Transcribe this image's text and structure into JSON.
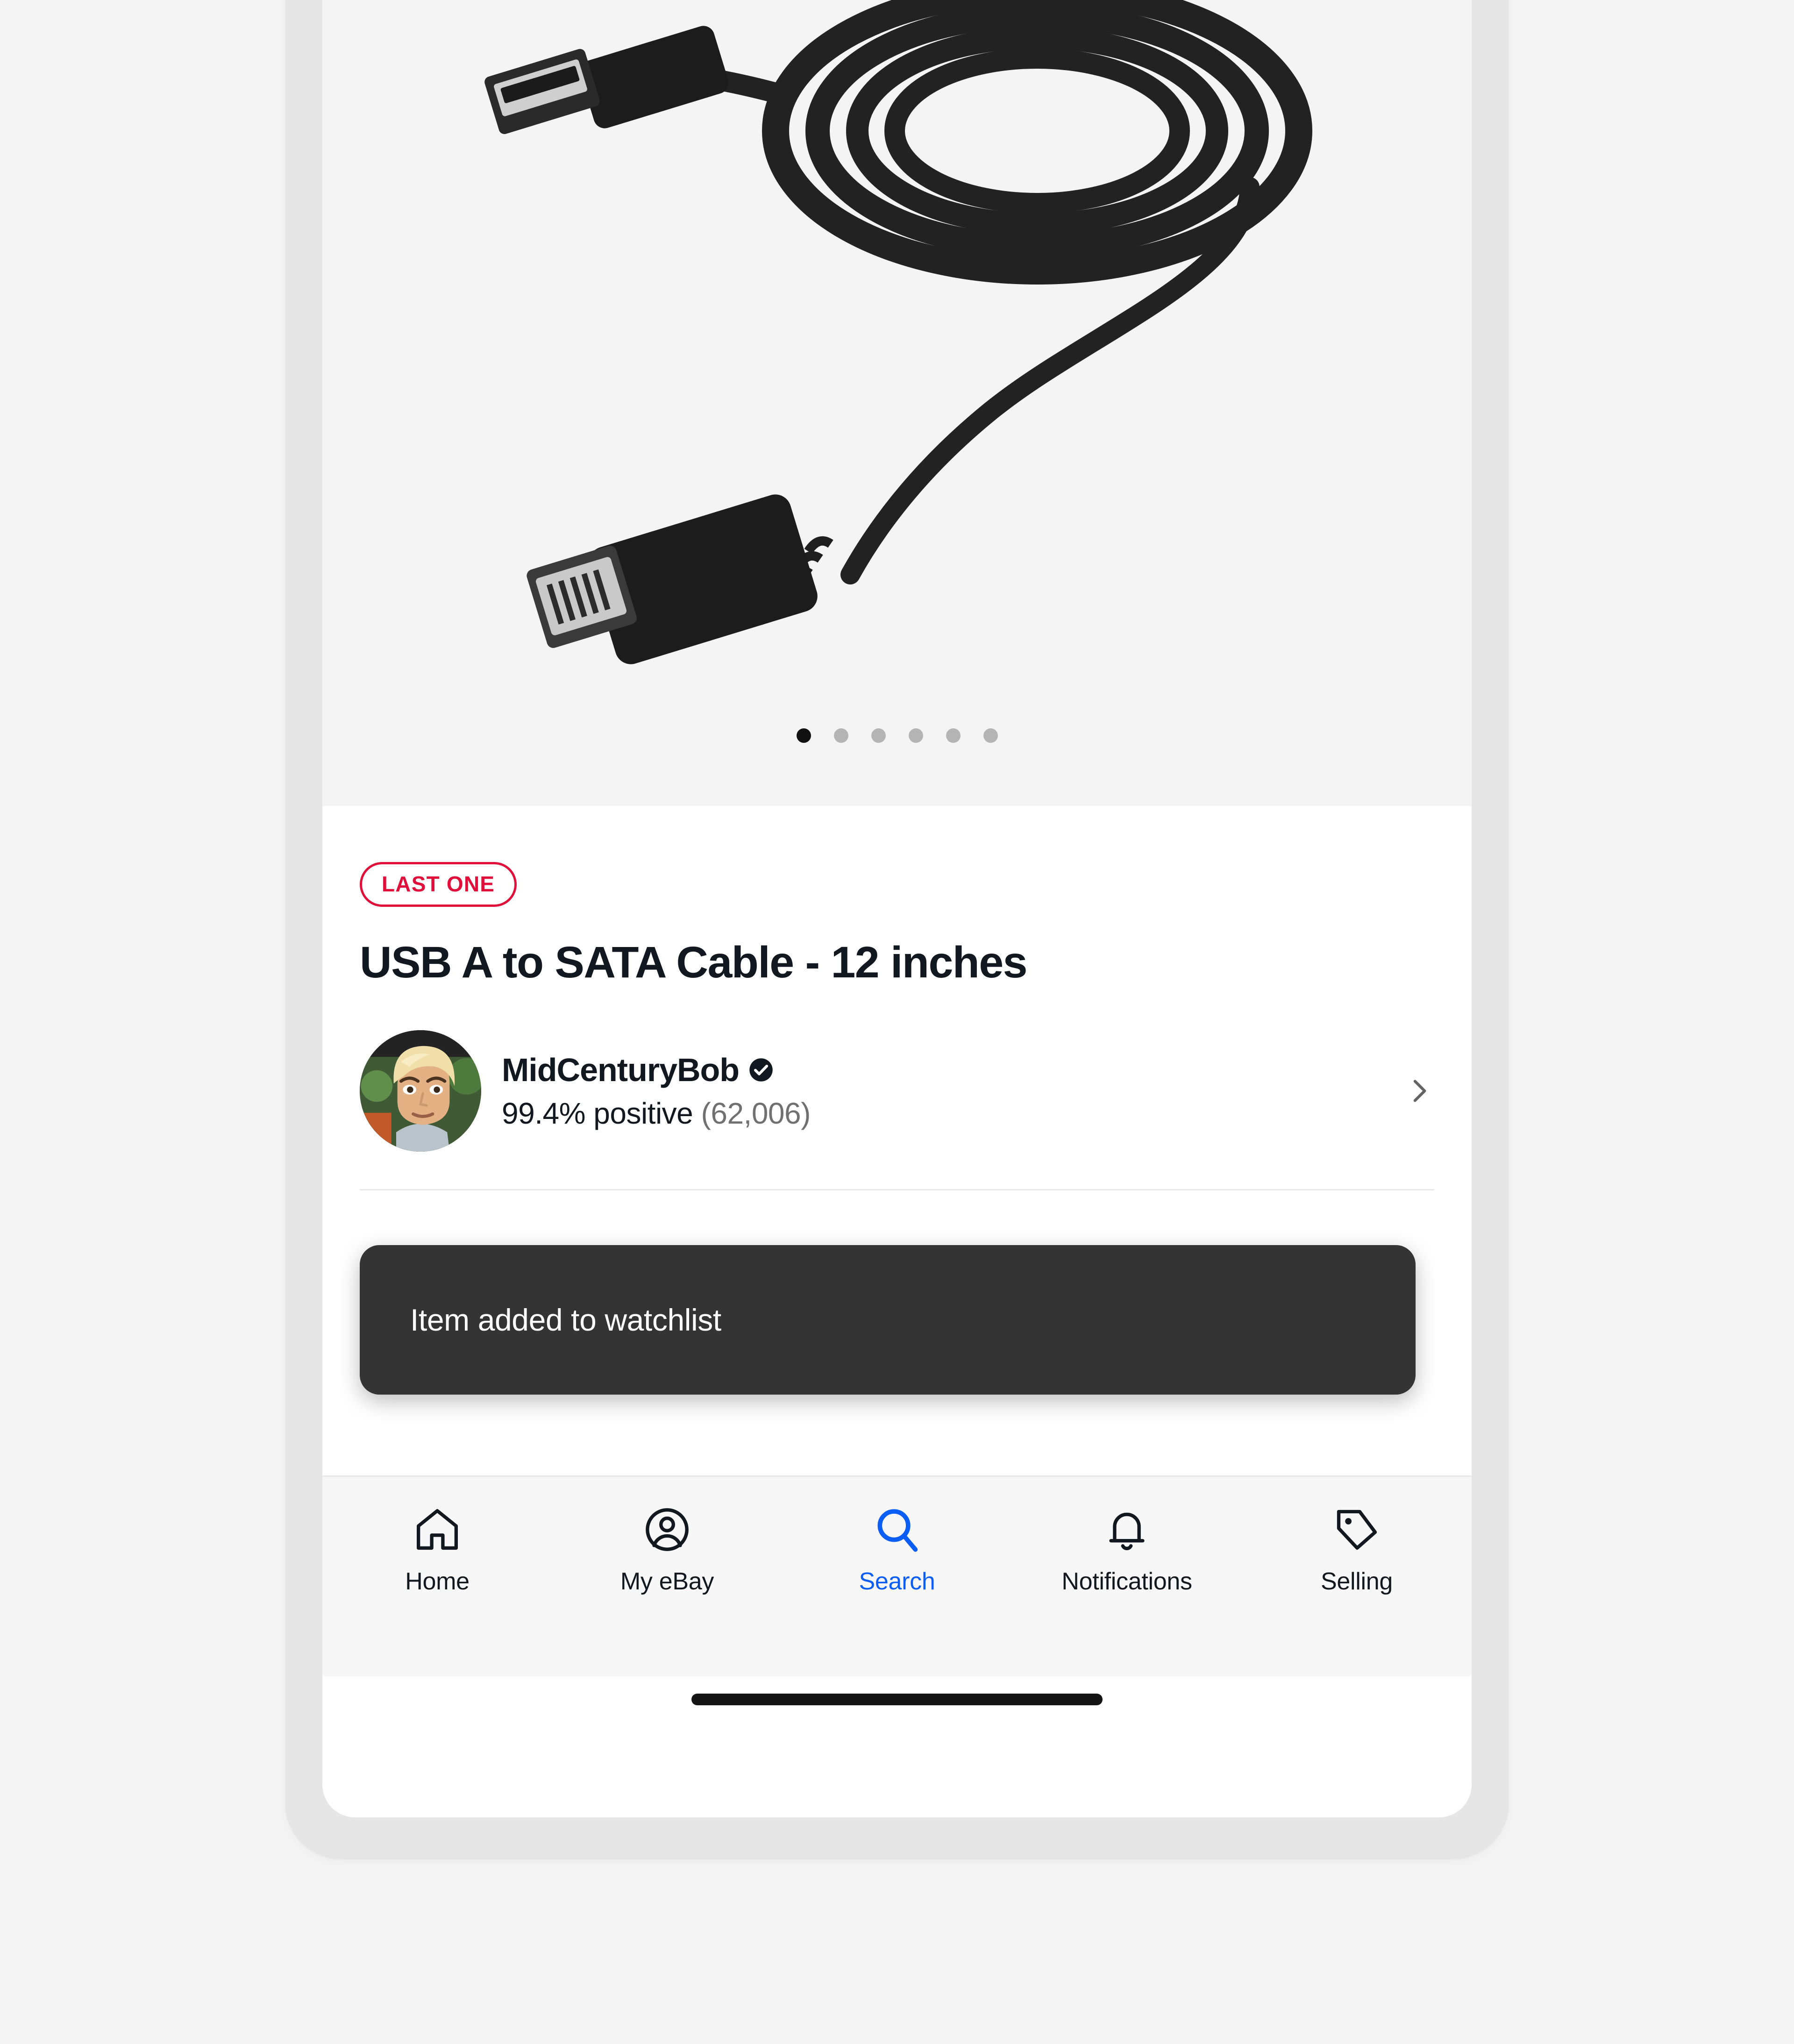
{
  "gallery": {
    "icon": "product-photo-usb-sata-cable",
    "alt_description": "Coiled black USB A to 30-pin dock connector cable",
    "total_slides": 6,
    "active_slide": 1
  },
  "item": {
    "badge_label": "LAST ONE",
    "badge_color": "#e0103a",
    "title": "USB A to SATA Cable - 12 inches"
  },
  "seller": {
    "avatar_icon": "seller-avatar-photo",
    "name": "MidCenturyBob",
    "verified_icon": "verified-checkmark-icon",
    "feedback_percent": "99.4% positive",
    "feedback_count": "(62,006)",
    "chevron_icon": "chevron-right-icon"
  },
  "toast": {
    "message": "Item added to watchlist",
    "background": "#343434"
  },
  "bottom_nav": {
    "active_color": "#0a5ef5",
    "items": [
      {
        "label": "Home",
        "icon": "home-icon",
        "active": false
      },
      {
        "label": "My eBay",
        "icon": "person-circle-icon",
        "active": false
      },
      {
        "label": "Search",
        "icon": "search-icon",
        "active": true
      },
      {
        "label": "Notifications",
        "icon": "bell-icon",
        "active": false
      },
      {
        "label": "Selling",
        "icon": "tag-icon",
        "active": false
      }
    ]
  }
}
